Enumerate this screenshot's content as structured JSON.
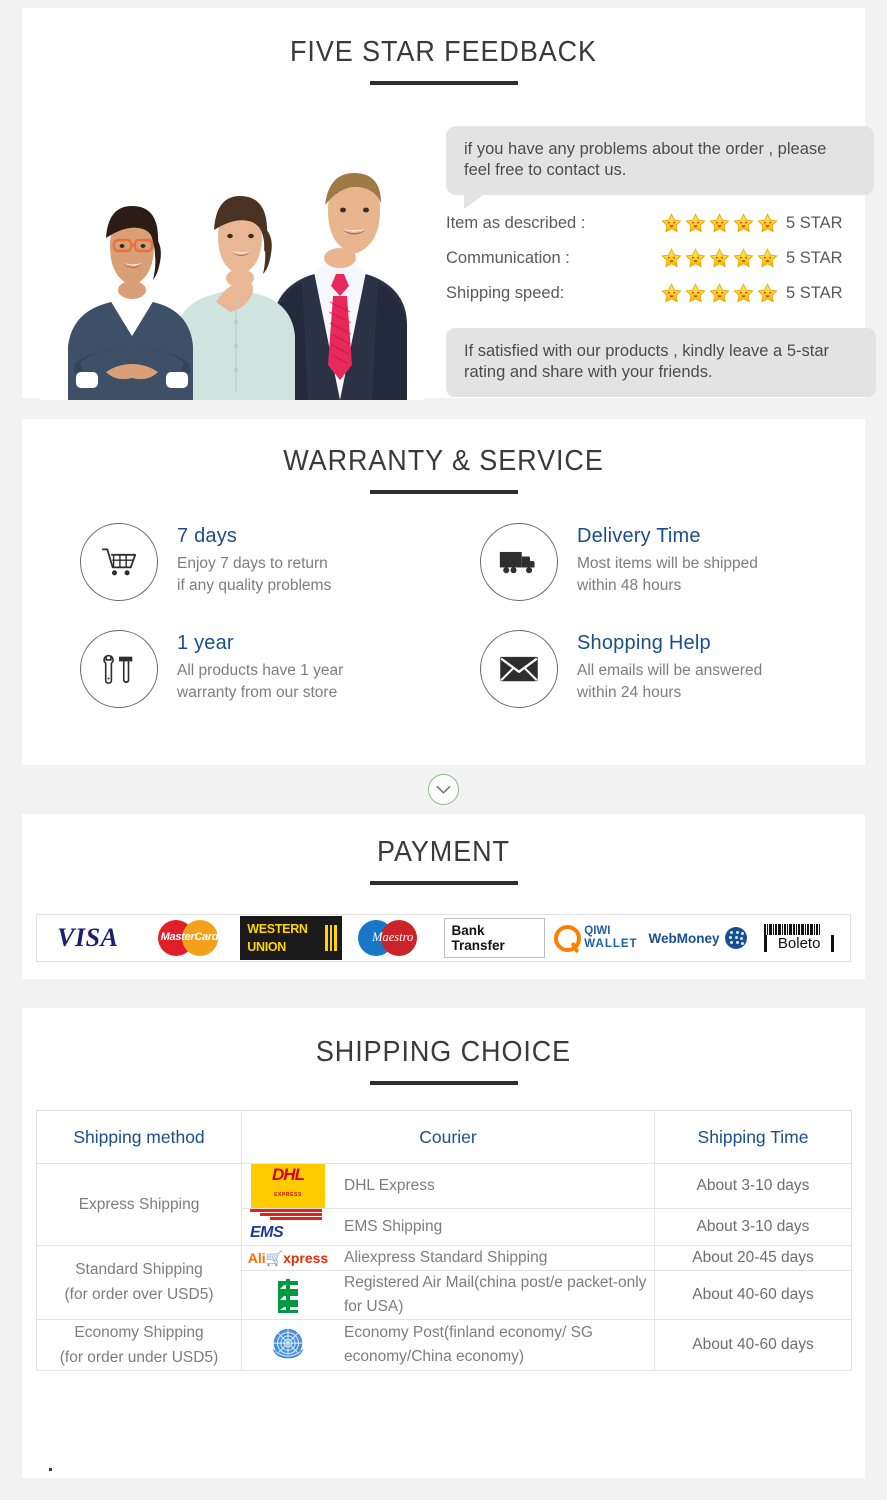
{
  "feedback": {
    "title": "FIVE STAR FEEDBACK",
    "bubble_text": "if you have any problems about the order , please feel free to contact us.",
    "ratings": [
      {
        "label": "Item as described :",
        "stars": 5,
        "value": "5 STAR"
      },
      {
        "label": "Communication :",
        "stars": 5,
        "value": "5 STAR"
      },
      {
        "label": "Shipping speed:",
        "stars": 5,
        "value": "5 STAR"
      }
    ],
    "promise_text": "If satisfied with our products ,  kindly leave a 5-star rating and share with your friends.",
    "photo_alt": "three-business-people"
  },
  "warranty": {
    "title": "WARRANTY & SERVICE",
    "items": [
      {
        "icon": "shopping-cart-icon",
        "heading": "7 days",
        "desc_line1": "Enjoy 7 days to return",
        "desc_line2": "if any quality problems"
      },
      {
        "icon": "truck-icon",
        "heading": "Delivery Time",
        "desc_line1": "Most items will be shipped",
        "desc_line2": "within 48 hours"
      },
      {
        "icon": "tools-icon",
        "heading": "1  year",
        "desc_line1": "All products have 1  year",
        "desc_line2": "warranty from our store"
      },
      {
        "icon": "envelope-icon",
        "heading": "Shopping Help",
        "desc_line1": "All emails will be answered",
        "desc_line2": "within 24 hours"
      }
    ]
  },
  "divider": {
    "icon": "chevron-down-icon"
  },
  "payment": {
    "title": "PAYMENT",
    "methods": [
      {
        "name": "VISA",
        "icon": "visa-logo"
      },
      {
        "name": "MasterCard",
        "icon": "mastercard-logo"
      },
      {
        "name": "WESTERN UNION",
        "line1": "WESTERN",
        "line2": "UNION",
        "icon": "western-union-logo"
      },
      {
        "name": "Maestro",
        "icon": "maestro-logo"
      },
      {
        "name": "Bank Transfer",
        "icon": "bank-transfer-logo"
      },
      {
        "name": "QIWI WALLET",
        "line1": "QIWI",
        "line2": "WALLET",
        "icon": "qiwi-wallet-logo"
      },
      {
        "name": "WebMoney",
        "icon": "webmoney-logo"
      },
      {
        "name": "Boleto",
        "icon": "boleto-logo"
      }
    ]
  },
  "shipping": {
    "title": "SHIPPING CHOICE",
    "columns": [
      "Shipping method",
      "Courier",
      "Shipping Time"
    ],
    "groups": [
      {
        "method_line1": "Express Shipping",
        "method_line2": "",
        "rows": [
          {
            "logo": "dhl-logo",
            "courier": "DHL Express",
            "time": "About 3-10 days"
          },
          {
            "logo": "ems-logo",
            "courier": "EMS Shipping",
            "time": "About 3-10 days"
          }
        ]
      },
      {
        "method_line1": "Standard Shipping",
        "method_line2": "(for order over USD5)",
        "rows": [
          {
            "logo": "aliexpress-logo",
            "courier": "Aliexpress Standard Shipping",
            "time": "About 20-45 days"
          },
          {
            "logo": "china-post-logo",
            "courier": "Registered Air Mail(china post/e packet-only for USA)",
            "time": "About 40-60 days"
          }
        ]
      },
      {
        "method_line1": "Economy Shipping",
        "method_line2": "(for order under USD5)",
        "rows": [
          {
            "logo": "united-nations-logo",
            "courier": "Economy Post(finland economy/ SG economy/China economy)",
            "time": "About 40-60 days"
          }
        ]
      }
    ]
  },
  "colors": {
    "heading_blue": "#1b4f8a",
    "body_gray": "#7d7d7d",
    "title_dark": "#3a3a3a",
    "bubble_gray": "#e3e3e3",
    "star_yellow": "#ffd21e",
    "page_bg": "#f2f2f2"
  }
}
